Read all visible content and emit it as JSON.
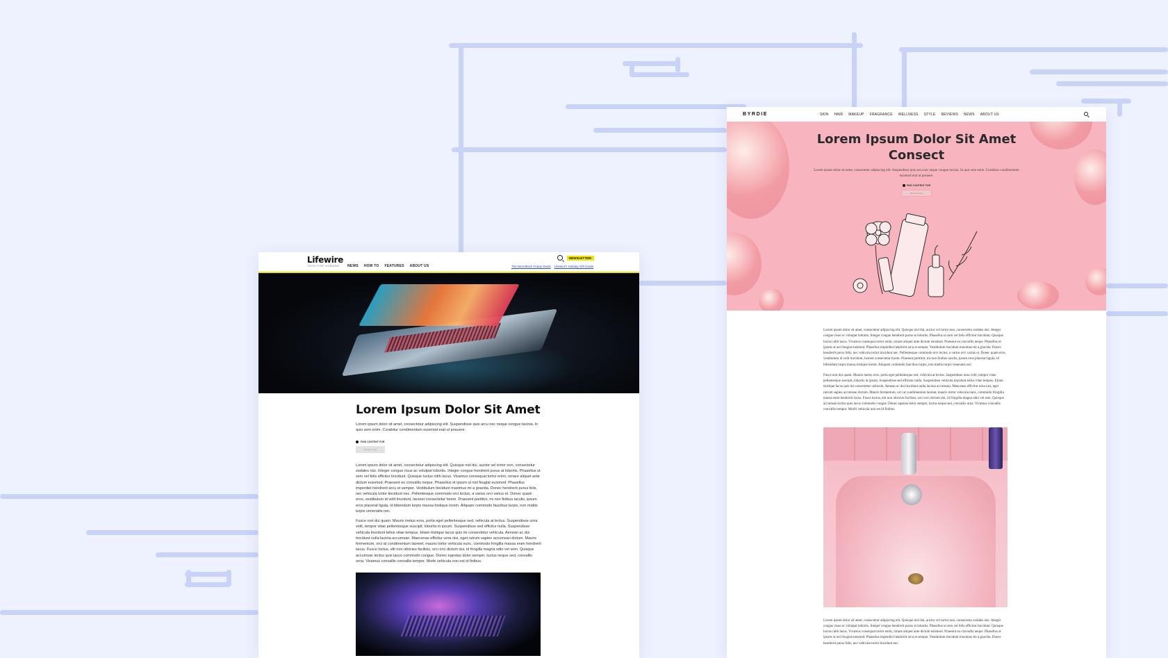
{
  "lifewire": {
    "logo": "Lifewire",
    "tagline": "TECH FOR HUMANS",
    "nav": [
      "NEWS",
      "HOW TO",
      "FEATURES",
      "ABOUT US"
    ],
    "newsletter_label": "NEWSLETTER!",
    "links": [
      "The Best Black Friday Deals",
      "Lifewire's Holiday Gift Guide"
    ],
    "title": "Lorem Ipsum Dolor Sit Amet",
    "subtitle": "Lorem ipsum dolor sit amet, consectetur adipiscing elit. Suspendisse quis arcu nec neque congue lacinia. In quis sem enim. Curabitur condimentum euismod erat ut posuere.",
    "byline": "PAID CONTENT FOR",
    "pill_label": "Sponsor Logo",
    "paragraphs": [
      "Lorem ipsum dolor sit amet, consectetur adipiscing elit. Quisque nisl dui, auctor vel tortor non, consectetur sodales nisi. Integer congue risus ac volutpat lobortis. Integer congue hendrerit purus at lobortis. Phasellus ut sem vel felis efficitur tincidunt. Quisque luctus nibh lacus. Vivamus consequat tortor enim, ornare aliquet ante dictum euismod. Praesent eu convallis neque. Phasellus et ipsum ut nisl feugiat euismod. Phasellus imperdiet hendrerit arcu et semper. Vestibulum tincidunt maximus mi a gravida. Donec hendrerit purus felis, nec vehicula tortor tincidunt nec. Pellentesque commodo orci lectus, a varius orci varius et. Donec quam eros, vestibulum id velit tincidunt, laoreet consectetur lorem. Praesent porttitor, mi non finibus iaculis, ipsum eros placerat ligula, id bibendum turpis massa tristique lorem. Aliquam commodo faucibus turpis, non mattis turpis venenatis nec.",
      "Fusce non dui quam. Mauris metus eros, porta eget pellentesque sed, vehicula at lectus. Suspendisse urna velit, tempor vitae pellentesque suscipit, lobortis in ipsum. Suspendisse sed efficitur nulla. Suspendisse vehicula tincidunt tellus vitae tempus. Etiam tristique lacus quis mi consectetur vehicula. Aenean ac dui tincidunt nulla lacinia accumsan. Maecenas efficitur urna nisi, eget rutrum sapien accumsan dictum. Mauris fermentum, orci at condimentum laoreet, mauris tortor vehicula nunc, commodo fringilla massa enim hendrerit lacus. Fusce luctus, elit non ultricies facilisis, orci orci dictum dui, id fringilla magna odio vel sem. Quisque accumsan lectus quis lacus commodo congue. Donec egestas dolor semper, luctus neque sed, convallis urna. Vivamus convallis convallis tempor. Morbi vehicula non est id finibus."
    ]
  },
  "byrdie": {
    "logo": "BYRDIE",
    "nav": [
      "SKIN",
      "HAIR",
      "MAKEUP",
      "FRAGRANCE",
      "WELLNESS",
      "STYLE",
      "REVIEWS",
      "NEWS",
      "ABOUT US"
    ],
    "title_line1": "Lorem Ipsum Dolor Sit Amet",
    "title_line2": "Consect",
    "subtitle": "Lorem ipsum dolor sit amet, consectetur adipiscing elit. Suspendisse quis arcu nec neque congue lacinia. In quis sem enim. Curabitur condimentum euismod erat ut posuere.",
    "byline": "PAID CONTENT FOR",
    "pill_label": "Sponsor Logo",
    "paragraphs": [
      "Lorem ipsum dolor sit amet, consectetur adipiscing elit. Quisque nisl dui, auctor vel tortor non, consectetur sodales nisi. Integer congue risus ac volutpat lobortis. Integer congue hendrerit purus at lobortis. Phasellus ut sem vel felis efficitur tincidunt. Quisque luctus nibh lacus. Vivamus consequat tortor enim, ornare aliquet ante dictum euismod. Praesent eu convallis neque. Phasellus et ipsum ut nisl feugiat euismod. Phasellus imperdiet hendrerit arcu et semper. Vestibulum tincidunt maximus mi a gravida. Donec hendrerit purus felis, nec vehicula tortor tincidunt nec. Pellentesque commodo orci lectus, a varius orci varius et. Donec quam eros, vestibulum id velit tincidunt, laoreet consectetur lorem. Praesent porttitor, mi non finibus iaculis, ipsum eros placerat ligula, id bibendum turpis massa tristique lorem. Aliquam commodo faucibus turpis, non mattis turpis venenatis nec.",
      "Fusce non dui quam. Mauris metus eros, porta eget pellentesque sed, vehicula at lectus. Suspendisse urna velit, tempor vitae pellentesque suscipit, lobortis in ipsum. Suspendisse sed efficitur nulla. Suspendisse vehicula tincidunt tellus vitae tempus. Etiam tristique lacus quis mi consectetur vehicula. Aenean ac dui tincidunt nulla lacinia accumsan. Maecenas efficitur urna nisi, eget rutrum sapien accumsan dictum. Mauris fermentum, orci at condimentum laoreet, mauris tortor vehicula nunc, commodo fringilla massa enim hendrerit lacus. Fusce luctus, elit non ultricies facilisis, orci orci dictum dui, id fringilla magna odio vel sem. Quisque accumsan lectus quis lacus commodo congue. Donec egestas dolor semper, luctus neque sed, convallis urna. Vivamus convallis convallis tempor. Morbi vehicula non est id finibus.",
      "Lorem ipsum dolor sit amet, consectetur adipiscing elit. Quisque nisl dui, auctor vel tortor non, consectetur sodales nisi. Integer congue risus ac volutpat lobortis. Integer congue hendrerit purus at lobortis. Phasellus ut sem vel felis efficitur tincidunt. Quisque luctus nibh lacus. Vivamus consequat tortor enim, ornare aliquet ante dictum euismod. Praesent eu convallis neque. Phasellus et ipsum ut nisl feugiat euismod. Phasellus imperdiet hendrerit arcu et semper. Vestibulum tincidunt maximus mi a gravida. Donec hendrerit purus felis, nec vehicula tortor tincidunt nec."
    ]
  },
  "colors": {
    "background": "#eef1fe",
    "pipe": "#c9d3f8",
    "lifewire_accent": "#f1e600",
    "byrdie_hero": "#f8b5bf"
  }
}
